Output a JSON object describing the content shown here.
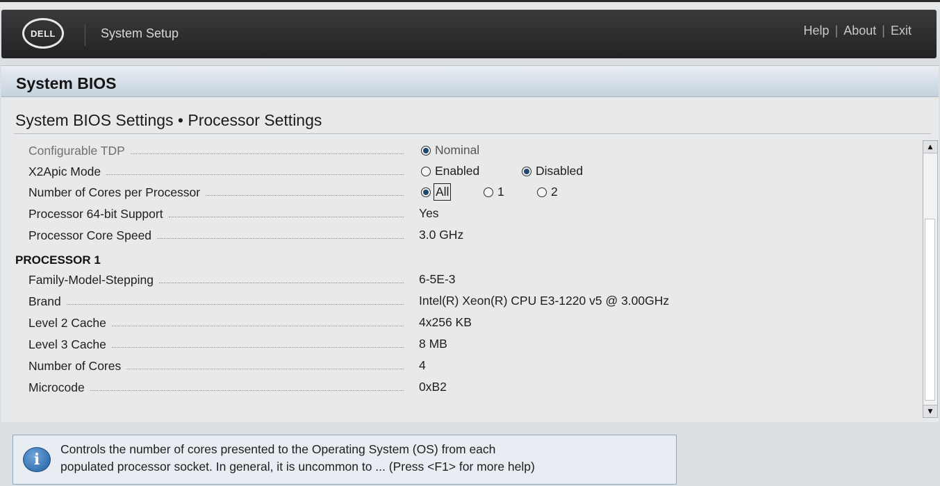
{
  "header": {
    "logo_text": "DELL",
    "app_title": "System Setup",
    "nav": [
      "Help",
      "About",
      "Exit"
    ],
    "nav_separator": "|"
  },
  "banner": {
    "title": "System BIOS"
  },
  "breadcrumb": "System BIOS Settings • Processor Settings",
  "settings": {
    "configurable_tdp": {
      "label": "Configurable TDP",
      "option": "Nominal",
      "selected": true,
      "disabled": true
    },
    "x2apic_mode": {
      "label": "X2Apic Mode",
      "options": [
        "Enabled",
        "Disabled"
      ],
      "selected": "Disabled"
    },
    "cores_per_processor": {
      "label": "Number of Cores per Processor",
      "options": [
        "All",
        "1",
        "2"
      ],
      "selected": "All"
    },
    "processor_64bit": {
      "label": "Processor 64-bit Support",
      "value": "Yes"
    },
    "core_speed": {
      "label": "Processor Core Speed",
      "value": "3.0 GHz"
    }
  },
  "processor1": {
    "heading": "PROCESSOR 1",
    "rows": [
      {
        "label": "Family-Model-Stepping",
        "value": "6-5E-3"
      },
      {
        "label": "Brand",
        "value": "Intel(R) Xeon(R) CPU E3-1220 v5 @ 3.00GHz"
      },
      {
        "label": "Level 2 Cache",
        "value": "4x256 KB"
      },
      {
        "label": "Level 3 Cache",
        "value": "8 MB"
      },
      {
        "label": "Number of Cores",
        "value": "4"
      },
      {
        "label": "Microcode",
        "value": "0xB2"
      }
    ]
  },
  "help": {
    "line1": "Controls the number of cores presented to the Operating System (OS) from each",
    "line2": "populated processor socket. In general, it is uncommon to ... (Press <F1> for more help)"
  },
  "icons": {
    "info": "info-icon",
    "scroll_up": "scroll-up-arrow-icon",
    "scroll_down": "scroll-down-arrow-icon"
  },
  "colors": {
    "header_bg": "#2e2e30",
    "banner_bg": "#d4dde6",
    "radio_fill": "#1f4870",
    "help_border": "#8ea6bc"
  }
}
